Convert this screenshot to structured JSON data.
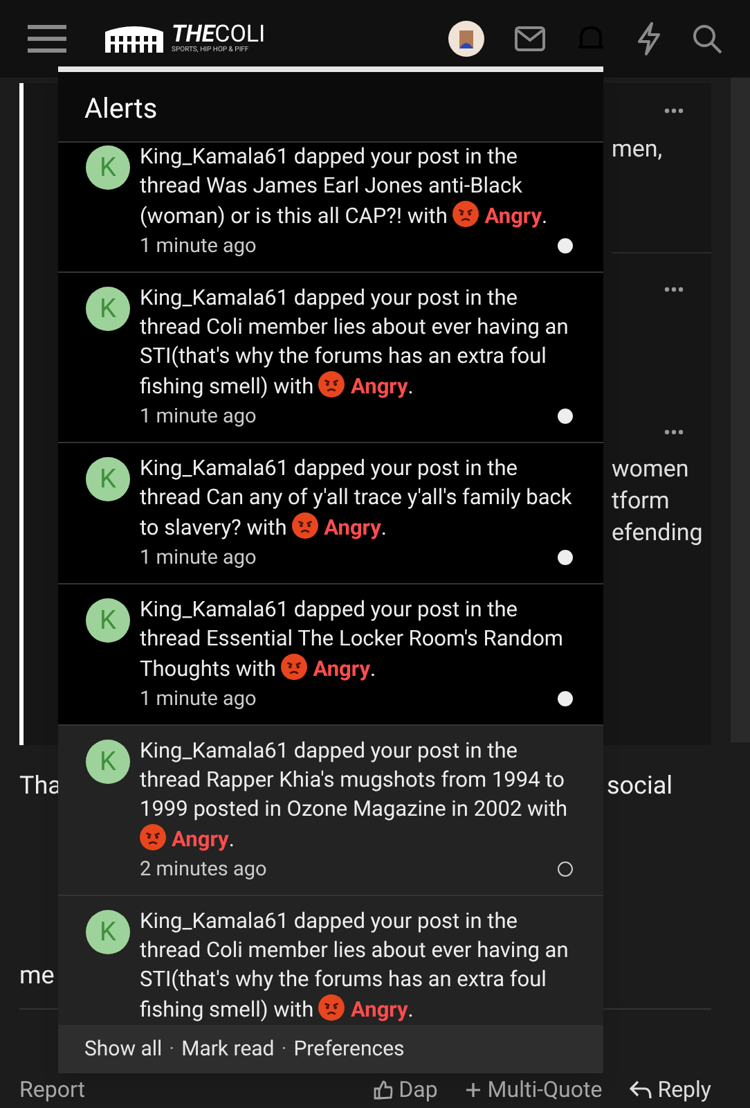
{
  "header": {
    "logo_title": "THE",
    "logo_title_bold": "COLI",
    "logo_tagline": "SPORTS, HIP HOP & PIFF",
    "bell_active": true
  },
  "background": {
    "snippets": [
      "men,",
      "women",
      "tform",
      "efending"
    ],
    "body_lines": [
      {
        "left": "Tha",
        "right": "social"
      },
      {
        "left": "me"
      }
    ],
    "actions": [
      "Report",
      "Dap",
      "Multi-Quote",
      "Reply"
    ]
  },
  "alerts": {
    "title": "Alerts",
    "items": [
      {
        "avatar": "K",
        "message": "King_Kamala61 dapped your post in the thread Was James Earl Jones anti-Black (woman) or is this all CAP?! with",
        "reaction": "Angry",
        "suffix": ".",
        "time": "1 minute ago",
        "unread": true
      },
      {
        "avatar": "K",
        "message": "King_Kamala61 dapped your post in the thread Coli member lies about ever having an STI(that's why the forums has an extra foul fishing smell) with",
        "reaction": "Angry",
        "suffix": ".",
        "time": "1 minute ago",
        "unread": true
      },
      {
        "avatar": "K",
        "message": "King_Kamala61 dapped your post in the thread Can any of y'all trace y'all's family back to slavery? with",
        "reaction": "Angry",
        "suffix": ".",
        "time": "1 minute ago",
        "unread": true
      },
      {
        "avatar": "K",
        "message": "King_Kamala61 dapped your post in the thread Essential The Locker Room's Random Thoughts with",
        "reaction": "Angry",
        "suffix": ".",
        "time": "1 minute ago",
        "unread": true
      },
      {
        "avatar": "K",
        "message": "King_Kamala61 dapped your post in the thread Rapper Khia's mugshots from 1994 to 1999 posted in Ozone Magazine in 2002 with",
        "reaction": "Angry",
        "suffix": ".",
        "time": "2 minutes ago",
        "unread": false
      },
      {
        "avatar": "K",
        "message": "King_Kamala61 dapped your post in the thread Coli member lies about ever having an STI(that's why the forums has an extra foul fishing smell) with",
        "reaction": "Angry",
        "suffix": ".",
        "unread": false
      }
    ],
    "footer": [
      "Show all",
      "Mark read",
      "Preferences"
    ],
    "footer_separator": "·"
  }
}
